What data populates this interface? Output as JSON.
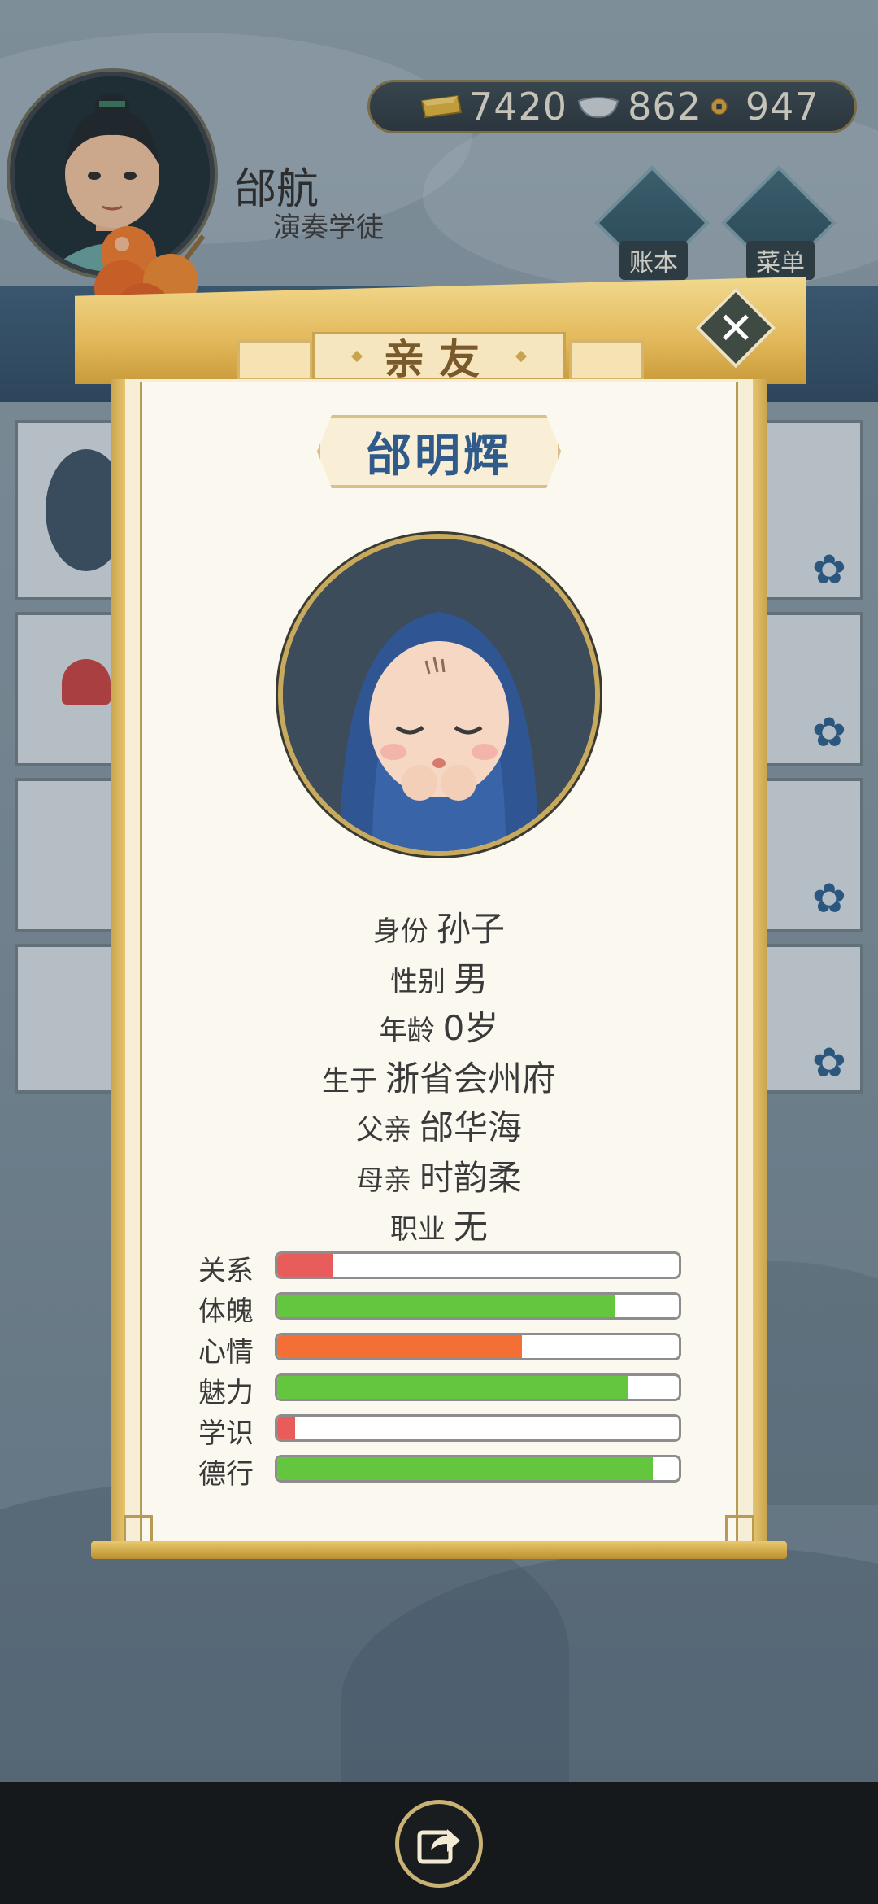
{
  "player": {
    "name": "邰航",
    "title": "演奏学徒"
  },
  "currency": {
    "gold": "7420",
    "silver": "862",
    "coin": "947"
  },
  "header_buttons": {
    "ledger_label": "账本",
    "menu_label": "菜单"
  },
  "panel": {
    "title": "亲友",
    "relative_name": "邰明辉",
    "info": [
      {
        "label": "身份",
        "value": "孙子"
      },
      {
        "label": "性别",
        "value": "男"
      },
      {
        "label": "年龄",
        "value": "0岁"
      },
      {
        "label": "生于",
        "value": "浙省会州府"
      },
      {
        "label": "父亲",
        "value": "邰华海"
      },
      {
        "label": "母亲",
        "value": "时韵柔"
      },
      {
        "label": "职业",
        "value": "无"
      }
    ],
    "stats": [
      {
        "label": "关系",
        "value": 0.14,
        "color": "#e85c5c"
      },
      {
        "label": "体魄",
        "value": 0.84,
        "color": "#64c53f"
      },
      {
        "label": "心情",
        "value": 0.61,
        "color": "#f36f35"
      },
      {
        "label": "魅力",
        "value": 0.875,
        "color": "#64c53f"
      },
      {
        "label": "学识",
        "value": 0.045,
        "color": "#e85c5c"
      },
      {
        "label": "德行",
        "value": 0.935,
        "color": "#64c53f"
      }
    ]
  },
  "colors": {
    "accent_gold": "#c9a450",
    "name_blue": "#2f5a8a"
  },
  "icons": [
    "gold-ingot-icon",
    "silver-ingot-icon",
    "copper-coin-icon",
    "close-icon",
    "share-icon",
    "persimmon-skewer-icon",
    "plum-blossom-icon"
  ]
}
